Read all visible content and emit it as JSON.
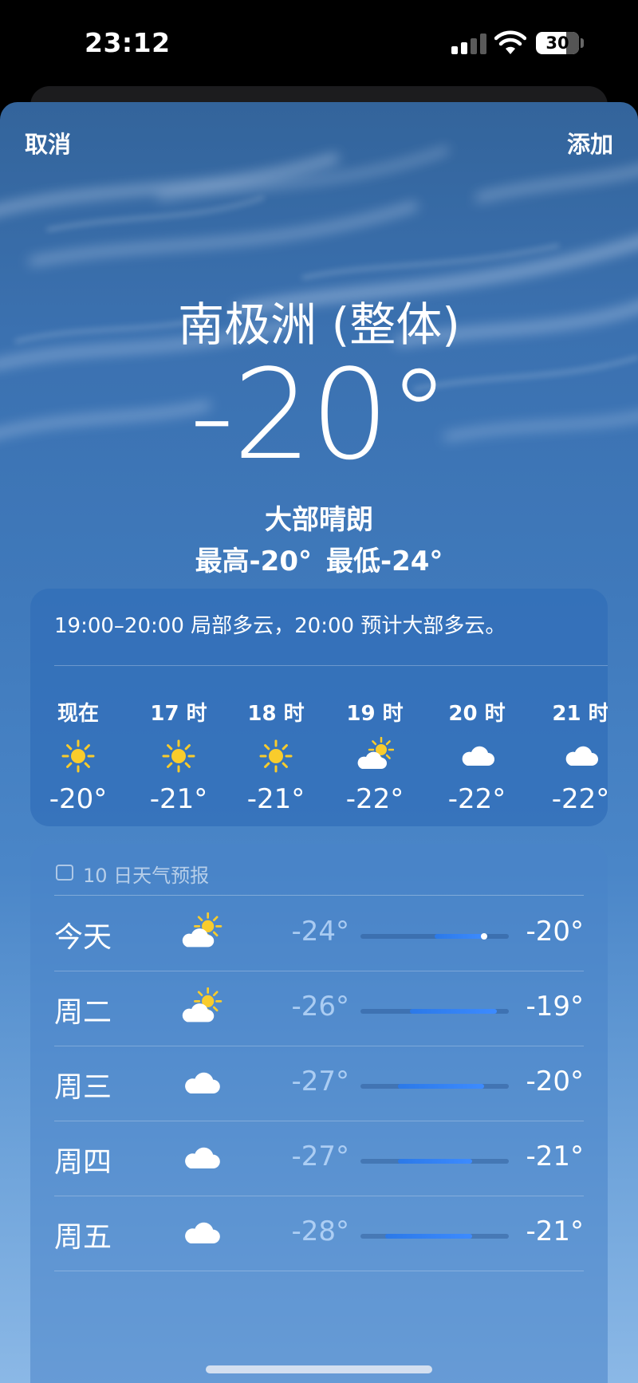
{
  "status_bar": {
    "time": "23:12",
    "battery": "30"
  },
  "sheet": {
    "cancel_label": "取消",
    "add_label": "添加"
  },
  "current": {
    "location": "南极洲 (整体)",
    "temperature": "-20°",
    "condition": "大部晴朗",
    "high": "最高-20°",
    "low": "最低-24°"
  },
  "hourly": {
    "summary": "19:00–20:00 局部多云，20:00 预计大部多云。",
    "items": [
      {
        "label": "现在",
        "icon": "sun-icon",
        "temp": "-20°"
      },
      {
        "label": "17 时",
        "icon": "sun-icon",
        "temp": "-21°"
      },
      {
        "label": "18 时",
        "icon": "sun-icon",
        "temp": "-21°"
      },
      {
        "label": "19 时",
        "icon": "partly-cloudy-icon",
        "temp": "-22°"
      },
      {
        "label": "20 时",
        "icon": "cloud-icon",
        "temp": "-22°"
      },
      {
        "label": "21 时",
        "icon": "cloud-icon",
        "temp": "-22°"
      }
    ]
  },
  "daily": {
    "title": "10 日天气预报",
    "icon": "calendar-icon",
    "range_min": -30,
    "range_max": -18,
    "current_temp": -20,
    "days": [
      {
        "name": "今天",
        "icon": "partly-cloudy-icon",
        "low": "-24°",
        "high": "-20°",
        "low_value": -24,
        "high_value": -20,
        "show_current": true
      },
      {
        "name": "周二",
        "icon": "partly-cloudy-icon",
        "low": "-26°",
        "high": "-19°",
        "low_value": -26,
        "high_value": -19,
        "show_current": false
      },
      {
        "name": "周三",
        "icon": "cloud-icon",
        "low": "-27°",
        "high": "-20°",
        "low_value": -27,
        "high_value": -20,
        "show_current": false
      },
      {
        "name": "周四",
        "icon": "cloud-icon",
        "low": "-27°",
        "high": "-21°",
        "low_value": -27,
        "high_value": -21,
        "show_current": false
      },
      {
        "name": "周五",
        "icon": "cloud-icon",
        "low": "-28°",
        "high": "-21°",
        "low_value": -28,
        "high_value": -21,
        "show_current": false
      }
    ]
  },
  "colors": {
    "sun": "#f9cc2c",
    "temp_bar": "#2f80f0",
    "sky_top": "#33649b",
    "sky_bottom": "#8bb8e6"
  }
}
